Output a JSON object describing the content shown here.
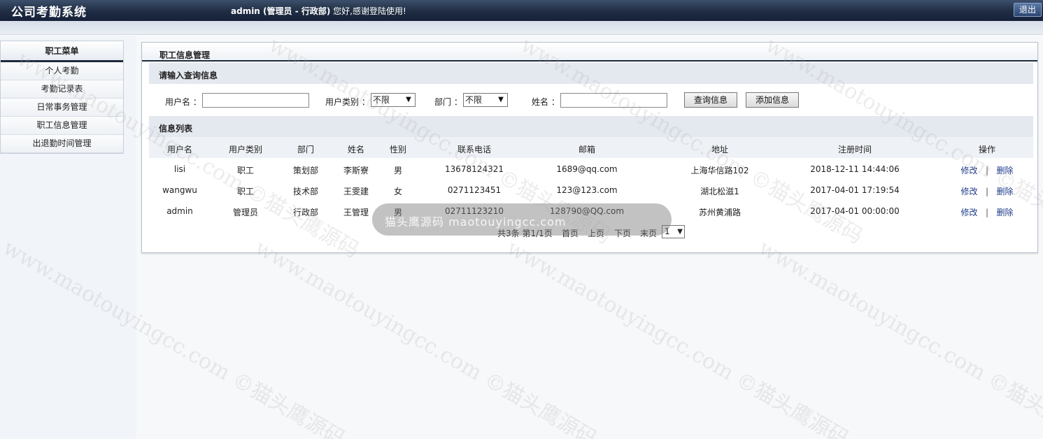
{
  "header": {
    "app_title": "公司考勤系统",
    "welcome_user": "admin (管理员 - 行政部)",
    "welcome_text": " 您好,感谢登陆使用!",
    "logout_label": "退出"
  },
  "sidebar": {
    "title": "职工菜单",
    "items": [
      {
        "label": "个人考勤"
      },
      {
        "label": "考勤记录表"
      },
      {
        "label": "日常事务管理"
      },
      {
        "label": "职工信息管理"
      },
      {
        "label": "出退勤时间管理"
      }
    ]
  },
  "main": {
    "panel_title": "职工信息管理",
    "query_section_title": "请输入查询信息",
    "query": {
      "username_label": "用户名 ：",
      "username_value": "",
      "usertype_label": "用户类别 ：",
      "usertype_selected": "不限",
      "dept_label": "部门 ：",
      "dept_selected": "不限",
      "name_label": "姓名 ：",
      "name_value": "",
      "search_button": "查询信息",
      "add_button": "添加信息"
    },
    "list_section_title": "信息列表",
    "table": {
      "columns": [
        "用户名",
        "用户类别",
        "部门",
        "姓名",
        "性别",
        "联系电话",
        "邮箱",
        "地址",
        "注册时间",
        "操作"
      ],
      "rows": [
        {
          "username": "lisi",
          "type": "职工",
          "dept": "策划部",
          "name": "李斯寮",
          "gender": "男",
          "phone": "13678124321",
          "email": "1689@qq.com",
          "address": "上海华信路102",
          "regtime": "2018-12-11 14:44:06"
        },
        {
          "username": "wangwu",
          "type": "职工",
          "dept": "技术部",
          "name": "王雯建",
          "gender": "女",
          "phone": "0271123451",
          "email": "123@123.com",
          "address": "湖北松滋1",
          "regtime": "2017-04-01 17:19:54"
        },
        {
          "username": "admin",
          "type": "管理员",
          "dept": "行政部",
          "name": "王管理",
          "gender": "男",
          "phone": "02711123210",
          "email": "128790@QQ.com",
          "address": "苏州黄浦路",
          "regtime": "2017-04-01 00:00:00"
        }
      ],
      "edit_label": "修改",
      "separator": "|",
      "delete_label": "删除"
    },
    "pager": {
      "summary": "共3条  第1/1页",
      "first": "首页",
      "prev": "上页",
      "next": "下页",
      "last": "末页",
      "page_selected": "1"
    }
  },
  "watermark": {
    "bubble_text": "猫头鹰源码 maotouyingcc.com",
    "text": "www.maotouyingcc.com ©猫头鹰源码"
  }
}
